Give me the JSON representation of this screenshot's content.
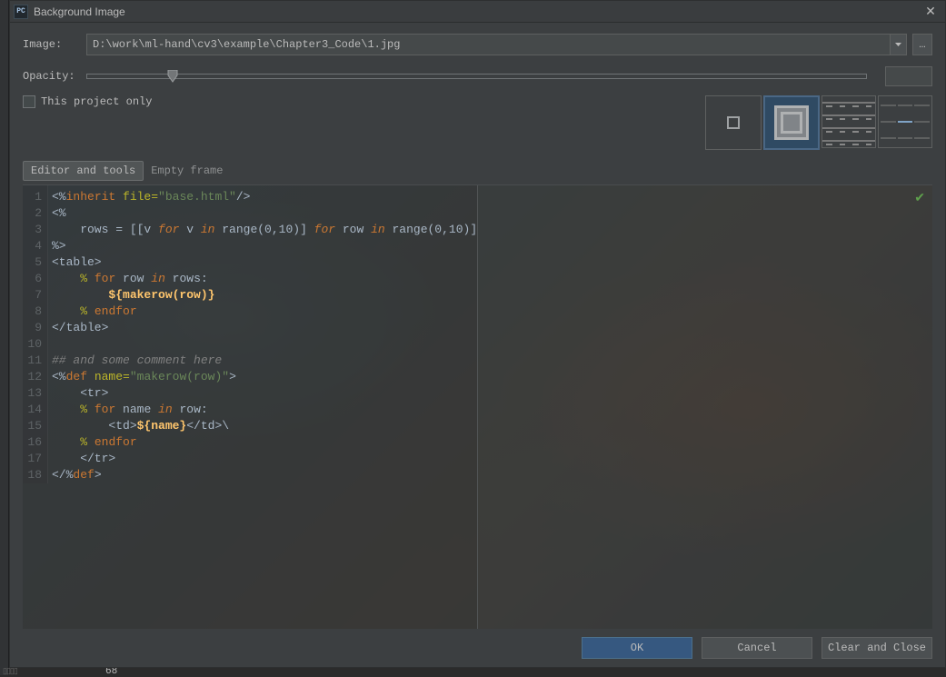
{
  "window": {
    "title": "Background Image",
    "app_icon_label": "PC"
  },
  "fields": {
    "image_label": "Image:",
    "image_value": "D:\\work\\ml-hand\\cv3\\example\\Chapter3_Code\\1.jpg",
    "opacity_label": "Opacity:",
    "opacity_value": "11",
    "opacity_percent": 11,
    "project_only_label": "This project only",
    "ellipsis": "…"
  },
  "tabs": {
    "editor": "Editor and tools",
    "empty": "Empty frame"
  },
  "buttons": {
    "ok": "OK",
    "cancel": "Cancel",
    "clear": "Clear and Close"
  },
  "status": {
    "bottom_num": "68"
  },
  "code_lines": [
    {
      "n": "1",
      "html": "&lt;%<span class='kw-orange-b'>inherit</span> <span class='kw-yellow'>file=</span><span class='kw-green'>\"base.html\"</span>/&gt;"
    },
    {
      "n": "2",
      "html": "&lt;%"
    },
    {
      "n": "3",
      "html": "    rows = [[v <span class='kw-orange'>for</span> v <span class='kw-orange'>in</span> range(0,10)] <span class='kw-orange'>for</span> row <span class='kw-orange'>in</span> range(0,10)]"
    },
    {
      "n": "4",
      "html": "%&gt;"
    },
    {
      "n": "5",
      "html": "&lt;table&gt;"
    },
    {
      "n": "6",
      "html": "    <span class='kw-yellow'>%</span> <span class='kw-orange-b'>for</span> row <span class='kw-orange'>in</span> rows:"
    },
    {
      "n": "7",
      "html": "        <span class='kw-bracehl'>${makerow(row)}</span>"
    },
    {
      "n": "8",
      "html": "    <span class='kw-yellow'>%</span> <span class='kw-orange-b'>endfor</span>"
    },
    {
      "n": "9",
      "html": "&lt;/table&gt;"
    },
    {
      "n": "10",
      "html": ""
    },
    {
      "n": "11",
      "html": "<span class='kw-comment'>## and some comment here</span>"
    },
    {
      "n": "12",
      "html": "&lt;%<span class='kw-orange-b'>def</span> <span class='kw-yellow'>name=</span><span class='kw-green'>\"makerow(row)\"</span>&gt;"
    },
    {
      "n": "13",
      "html": "    &lt;tr&gt;"
    },
    {
      "n": "14",
      "html": "    <span class='kw-yellow'>%</span> <span class='kw-orange-b'>for</span> name <span class='kw-orange'>in</span> row:"
    },
    {
      "n": "15",
      "html": "        &lt;td&gt;<span class='kw-bracehl'>${name}</span>&lt;/td&gt;\\"
    },
    {
      "n": "16",
      "html": "    <span class='kw-yellow'>%</span> <span class='kw-orange-b'>endfor</span>"
    },
    {
      "n": "17",
      "html": "    &lt;/tr&gt;"
    },
    {
      "n": "18",
      "html": "&lt;/%<span class='kw-orange-b'>def</span>&gt;"
    }
  ]
}
